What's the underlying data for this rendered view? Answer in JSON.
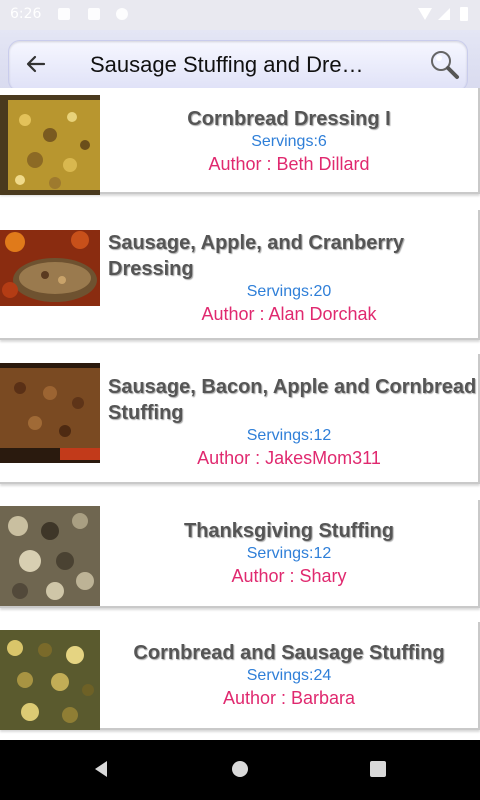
{
  "status": {
    "time": "6:26"
  },
  "toolbar": {
    "title": "Sausage Stuffing and Dre…"
  },
  "recipes": [
    {
      "name": "Cornbread Dressing I",
      "servings": "Servings:6",
      "author": "Author : Beth Dillard"
    },
    {
      "name": "Sausage, Apple, and Cranberry Dressing",
      "servings": "Servings:20",
      "author": "Author : Alan Dorchak"
    },
    {
      "name": "Sausage, Bacon, Apple and Cornbread Stuffing",
      "servings": "Servings:12",
      "author": "Author : JakesMom311"
    },
    {
      "name": "Thanksgiving Stuffing",
      "servings": "Servings:12",
      "author": "Author : Shary"
    },
    {
      "name": "Cornbread and Sausage Stuffing",
      "servings": "Servings:24",
      "author": "Author : Barbara"
    }
  ],
  "colors": {
    "servings": "#2f7fd8",
    "author": "#e0296f",
    "title": "#555555"
  },
  "icons": {
    "back": "arrow-left-icon",
    "search": "magnifier-icon"
  }
}
